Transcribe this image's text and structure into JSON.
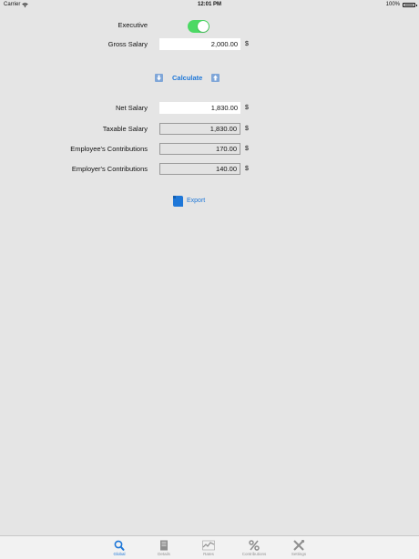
{
  "status": {
    "carrier": "Carrier",
    "time": "12:01 PM",
    "battery": "100%"
  },
  "form": {
    "executive_label": "Executive",
    "gross_salary_label": "Gross Salary",
    "gross_salary_value": "2,000.00",
    "currency": "$",
    "calculate_label": "Calculate",
    "net_salary_label": "Net Salary",
    "net_salary_value": "1,830.00",
    "taxable_salary_label": "Taxable Salary",
    "taxable_salary_value": "1,830.00",
    "employee_contrib_label": "Employee's Contributions",
    "employee_contrib_value": "170.00",
    "employer_contrib_label": "Employer's Contributions",
    "employer_contrib_value": "140.00",
    "export_label": "Export"
  },
  "tabs": [
    {
      "label": "Global",
      "icon": "search-icon",
      "active": true
    },
    {
      "label": "Details",
      "icon": "document-icon",
      "active": false
    },
    {
      "label": "Rates",
      "icon": "chart-line-icon",
      "active": false
    },
    {
      "label": "Contributions",
      "icon": "percent-icon",
      "active": false
    },
    {
      "label": "Settings",
      "icon": "tools-icon",
      "active": false
    }
  ],
  "colors": {
    "accent": "#1e77d8",
    "toggle_on": "#4cd964",
    "background": "#e5e5e5"
  }
}
